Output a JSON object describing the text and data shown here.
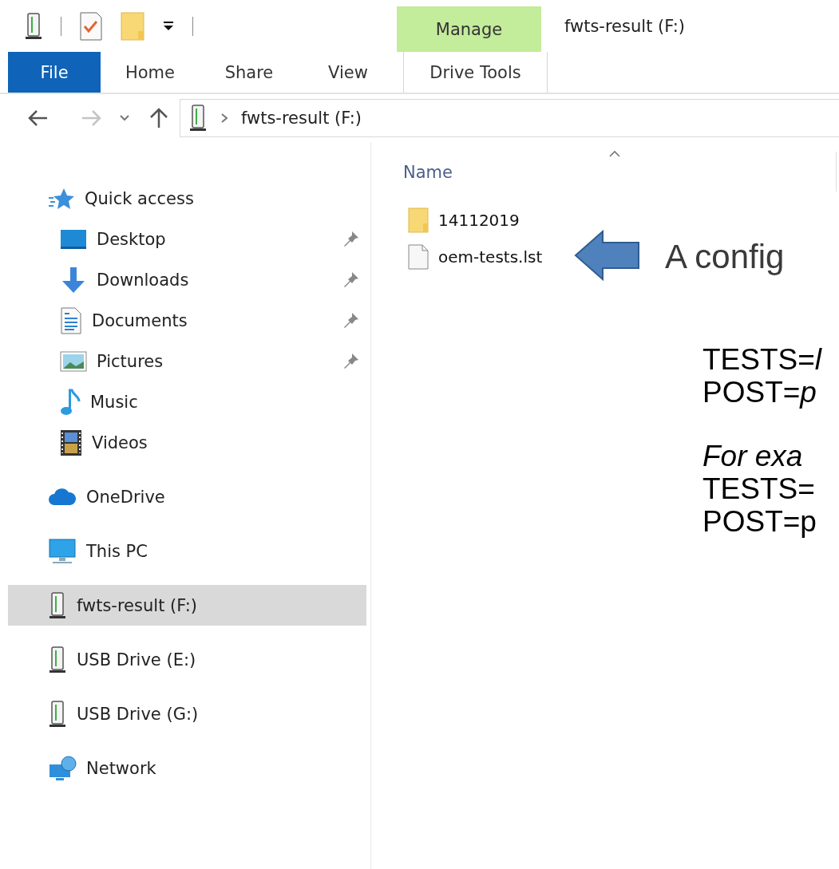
{
  "window": {
    "title": "fwts-result (F:)"
  },
  "context_tab": {
    "group": "Manage",
    "label": "Drive Tools"
  },
  "ribbon_tabs": [
    {
      "label": "File",
      "kind": "file"
    },
    {
      "label": "Home",
      "kind": "tab"
    },
    {
      "label": "Share",
      "kind": "tab"
    },
    {
      "label": "View",
      "kind": "tab"
    }
  ],
  "address_bar": {
    "path": [
      "fwts-result (F:)"
    ]
  },
  "navigation": [
    {
      "label": "Quick access",
      "kind": "star",
      "selected": false,
      "children": [
        {
          "label": "Desktop",
          "kind": "desktop",
          "pinned": true,
          "selected": false
        },
        {
          "label": "Downloads",
          "kind": "download",
          "pinned": true,
          "selected": false
        },
        {
          "label": "Documents",
          "kind": "document",
          "pinned": true,
          "selected": false
        },
        {
          "label": "Pictures",
          "kind": "pictures",
          "pinned": true,
          "selected": false
        },
        {
          "label": "Music",
          "kind": "music",
          "pinned": false,
          "selected": false
        },
        {
          "label": "Videos",
          "kind": "video",
          "pinned": false,
          "selected": false
        }
      ]
    },
    {
      "label": "OneDrive",
      "kind": "cloud",
      "selected": false
    },
    {
      "label": "This PC",
      "kind": "pc",
      "selected": false
    },
    {
      "label": "fwts-result (F:)",
      "kind": "drive",
      "selected": true
    },
    {
      "label": "USB Drive (E:)",
      "kind": "drive",
      "selected": false
    },
    {
      "label": "USB Drive (G:)",
      "kind": "drive",
      "selected": false
    },
    {
      "label": "Network",
      "kind": "network",
      "selected": false
    }
  ],
  "file_list": {
    "columns": [
      {
        "label": "Name",
        "sorted": true
      }
    ],
    "files": [
      {
        "name": "14112019",
        "kind": "folder"
      },
      {
        "name": "oem-tests.lst",
        "kind": "file"
      }
    ]
  },
  "annotation": {
    "callout": "A config",
    "groups": [
      [
        {
          "text": "TESTS=*l*",
          "italic": false
        },
        {
          "text": "POST=*p*",
          "italic": false
        }
      ],
      [
        {
          "text": "For exa",
          "italic": true
        },
        {
          "text": "TESTS=",
          "italic": false
        },
        {
          "text": "POST=p",
          "italic": false
        }
      ]
    ]
  }
}
